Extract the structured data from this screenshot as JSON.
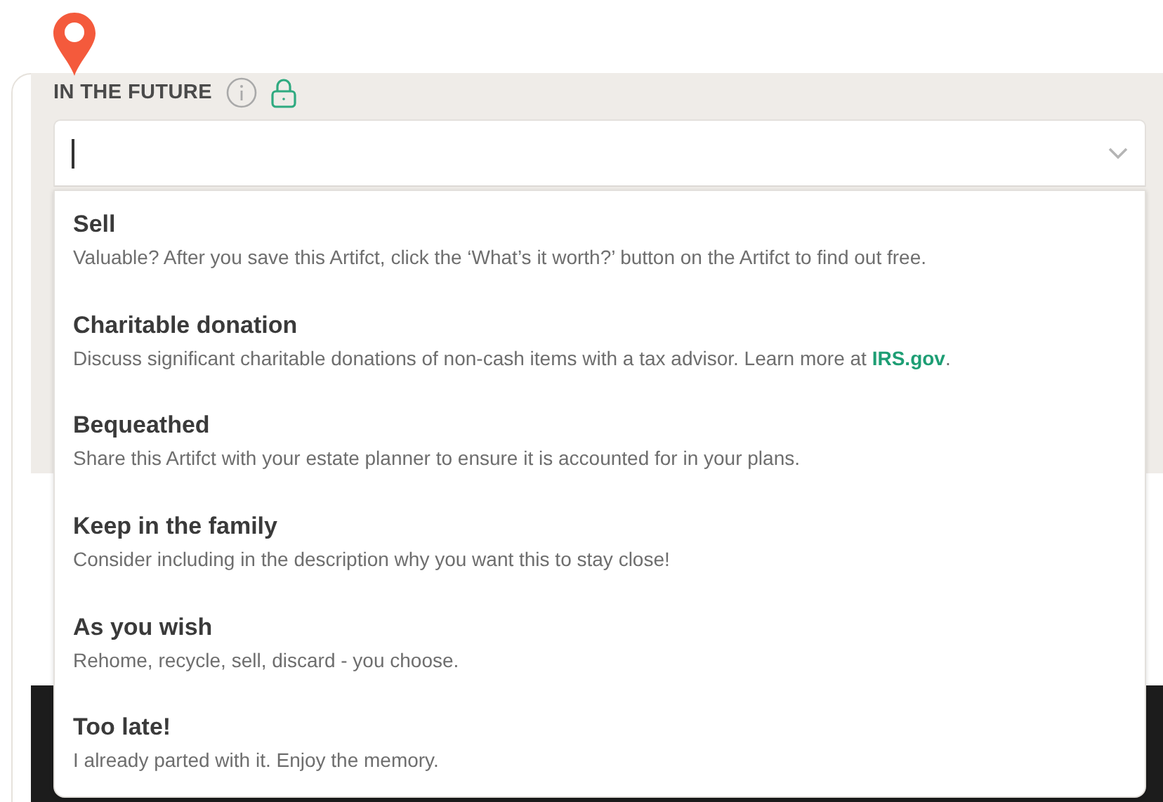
{
  "field": {
    "label": "IN THE FUTURE",
    "expanded": true
  },
  "options": [
    {
      "title": "Sell",
      "description": "Valuable? After you save this Artifct, click the ‘What’s it worth?’ button on the Artifct to find out free."
    },
    {
      "title": "Charitable donation",
      "description": "Discuss significant charitable donations of non-cash items with a tax advisor. Learn more at ",
      "link": "IRS.gov",
      "after": "."
    },
    {
      "title": "Bequeathed",
      "description": "Share this Artifct with your estate planner to ensure it is accounted for in your plans."
    },
    {
      "title": "Keep in the family",
      "description": "Consider including in the description why you want this to stay close!"
    },
    {
      "title": "As you wish",
      "description": "Rehome, recycle, sell, discard - you choose."
    },
    {
      "title": "Too late!",
      "description": "I already parted with it. Enjoy the memory."
    }
  ]
}
